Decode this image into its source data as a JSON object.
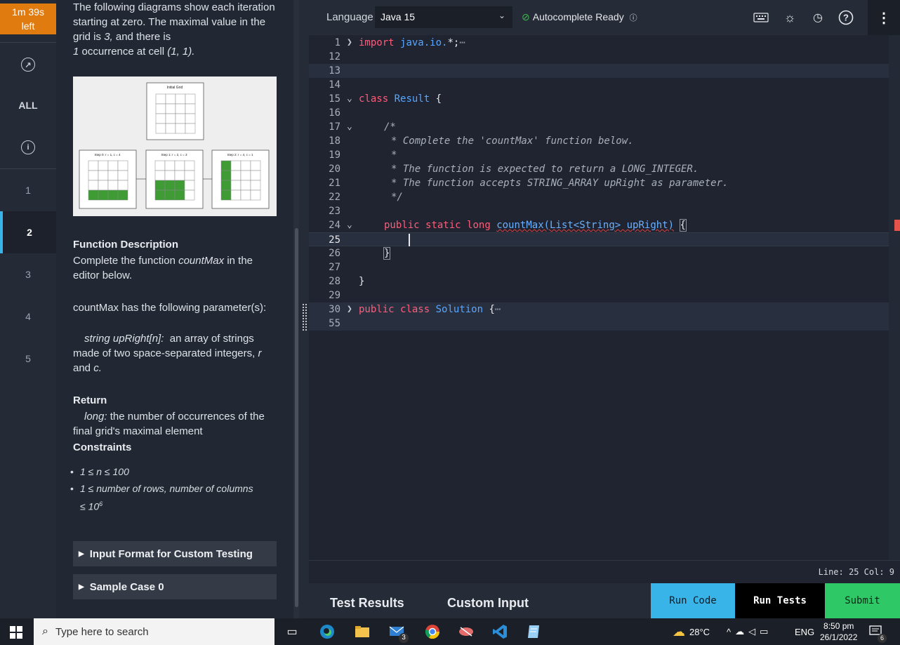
{
  "timer": {
    "line1": "1m 39s",
    "line2": "left"
  },
  "rail": {
    "all_label": "ALL",
    "questions": [
      "1",
      "2",
      "3",
      "4",
      "5"
    ],
    "active": "2"
  },
  "problem": {
    "intro": [
      "The following diagrams show each",
      "iteration starting at zero. The maximal",
      "value in the grid is",
      "3,",
      "and there is",
      "1",
      "occurrence at cell",
      "(1, 1)."
    ],
    "func_desc_heading": "Function Description",
    "func_desc_pre": "Complete the function",
    "func_desc_name": "countMax",
    "func_desc_post": "in the editor below.",
    "params_intro": "countMax has the following parameter(s):",
    "param_name": "string upRight[n]:",
    "param_desc": "an array of strings made of two space-separated integers,",
    "param_r": "r",
    "param_and": "and",
    "param_c": "c.",
    "return_heading": "Return",
    "return_type": "long:",
    "return_desc": "the number of occurrences of the final grid's maximal element",
    "constraints_heading": "Constraints",
    "constraint1": "1 ≤ n ≤ 100",
    "constraint2_a": "1 ≤ number of rows, number of columns",
    "constraint2_b": "≤ 10",
    "constraint2_exp": "6",
    "input_format": "Input Format for Custom Testing",
    "sample_case": "Sample Case 0"
  },
  "editor": {
    "language_label": "Language",
    "language_value": "Java 15",
    "autocomplete": "Autocomplete Ready",
    "status": "Line: 25 Col: 9",
    "tabs": [
      "Test Results",
      "Custom Input"
    ],
    "run_code": "Run Code",
    "run_tests": "Run Tests",
    "submit": "Submit",
    "lines": {
      "n1": "1",
      "n12": "12",
      "n13": "13",
      "n14": "14",
      "n15": "15",
      "n16": "16",
      "n17": "17",
      "n18": "18",
      "n19": "19",
      "n20": "20",
      "n21": "21",
      "n22": "22",
      "n23": "23",
      "n24": "24",
      "n25": "25",
      "n26": "26",
      "n27": "27",
      "n28": "28",
      "n29": "29",
      "n30": "30",
      "n55": "55"
    },
    "code": {
      "import_kw": "import",
      "import_pkg": "java.io.",
      "import_rest": "*;",
      "class_kw": "class",
      "class_name": "Result",
      "open_brace": "{",
      "c17": "/*",
      "c18": "* Complete the 'countMax' function below.",
      "c19": "*",
      "c20": "* The function is expected to return a LONG_INTEGER.",
      "c21": "* The function accepts STRING_ARRAY upRight as parameter.",
      "c22": "*/",
      "public_kw": "public",
      "static_kw": "static",
      "long_kw": "long",
      "method_name": "countMax(List<String> upRight)",
      "close_brace": "}",
      "class_kw2": "class",
      "solution_name": "Solution",
      "ellipsis": "⋯"
    }
  },
  "figure": {
    "initial_title": "Initial Grid",
    "step1_title": "Step 0: r = 1, c = 4",
    "step2_title": "Step 1: r = 2, c = 3",
    "step3_title": "Step 2: r = 4, c = 1",
    "accent_green": "#3f9c35"
  },
  "taskbar": {
    "search_placeholder": "Type here to search",
    "temperature": "28°C",
    "lang": "ENG",
    "time": "8:50 pm",
    "date": "26/1/2022",
    "mail_badge": "3",
    "notif_badge": "6"
  },
  "colors": {
    "timer_bg": "#e07b10",
    "run_code_bg": "#39b4e8",
    "run_tests_bg": "#000000",
    "submit_bg": "#2ec866",
    "active_rail": "#39b4e8"
  }
}
